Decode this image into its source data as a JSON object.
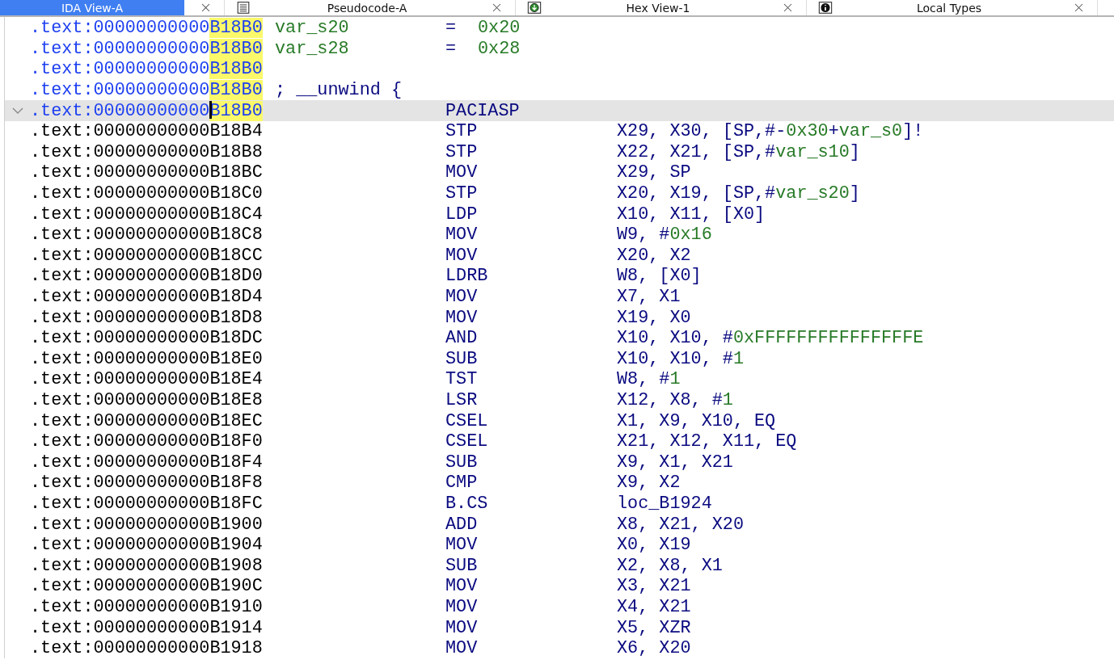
{
  "tabs": [
    {
      "label": "IDA View-A",
      "selected": true
    },
    {
      "label": "Pseudocode-A",
      "selected": false
    },
    {
      "label": "Hex View-1",
      "selected": false
    },
    {
      "label": "Local Types",
      "selected": false
    }
  ],
  "lines": [
    {
      "kind": "header",
      "addr": ".text:00000000000",
      "addr_tail": "B18B0",
      "highlight": true,
      "active": true,
      "selected": false,
      "label": "var_s20",
      "mnemonic": "=",
      "operands": [
        {
          "text": "0x20",
          "kind": "num"
        }
      ]
    },
    {
      "kind": "header",
      "addr": ".text:00000000000",
      "addr_tail": "B18B0",
      "highlight": true,
      "active": true,
      "selected": false,
      "label": "var_s28",
      "mnemonic": "=",
      "operands": [
        {
          "text": "0x28",
          "kind": "num"
        }
      ]
    },
    {
      "kind": "header",
      "addr": ".text:00000000000",
      "addr_tail": "B18B0",
      "highlight": true,
      "active": true,
      "selected": false
    },
    {
      "kind": "header",
      "addr": ".text:00000000000",
      "addr_tail": "B18B0",
      "highlight": true,
      "active": true,
      "selected": false,
      "comment": "; __unwind {"
    },
    {
      "kind": "code",
      "addr": ".text:00000000000",
      "addr_tail": "B18B0",
      "highlight": true,
      "active": true,
      "selected": true,
      "mnemonic": "PACIASP"
    },
    {
      "kind": "code",
      "addr": ".text:00000000000",
      "addr_tail": "B18B4",
      "highlight": false,
      "active": false,
      "selected": false,
      "mnemonic": "STP",
      "operands": [
        {
          "text": "X29, X30, [SP,#-",
          "kind": "reg"
        },
        {
          "text": "0x30",
          "kind": "num"
        },
        {
          "text": "+",
          "kind": "reg"
        },
        {
          "text": "var_s0",
          "kind": "num"
        },
        {
          "text": "]!",
          "kind": "reg"
        }
      ]
    },
    {
      "kind": "code",
      "addr": ".text:00000000000",
      "addr_tail": "B18B8",
      "highlight": false,
      "active": false,
      "selected": false,
      "mnemonic": "STP",
      "operands": [
        {
          "text": "X22, X21, [SP,#",
          "kind": "reg"
        },
        {
          "text": "var_s10",
          "kind": "num"
        },
        {
          "text": "]",
          "kind": "reg"
        }
      ]
    },
    {
      "kind": "code",
      "addr": ".text:00000000000",
      "addr_tail": "B18BC",
      "highlight": false,
      "active": false,
      "selected": false,
      "mnemonic": "MOV",
      "operands": [
        {
          "text": "X29, SP",
          "kind": "reg"
        }
      ]
    },
    {
      "kind": "code",
      "addr": ".text:00000000000",
      "addr_tail": "B18C0",
      "highlight": false,
      "active": false,
      "selected": false,
      "mnemonic": "STP",
      "operands": [
        {
          "text": "X20, X19, [SP,#",
          "kind": "reg"
        },
        {
          "text": "var_s20",
          "kind": "num"
        },
        {
          "text": "]",
          "kind": "reg"
        }
      ]
    },
    {
      "kind": "code",
      "addr": ".text:00000000000",
      "addr_tail": "B18C4",
      "highlight": false,
      "active": false,
      "selected": false,
      "mnemonic": "LDP",
      "operands": [
        {
          "text": "X10, X11, [X0]",
          "kind": "reg"
        }
      ]
    },
    {
      "kind": "code",
      "addr": ".text:00000000000",
      "addr_tail": "B18C8",
      "highlight": false,
      "active": false,
      "selected": false,
      "mnemonic": "MOV",
      "operands": [
        {
          "text": "W9, #",
          "kind": "reg"
        },
        {
          "text": "0x16",
          "kind": "num"
        }
      ]
    },
    {
      "kind": "code",
      "addr": ".text:00000000000",
      "addr_tail": "B18CC",
      "highlight": false,
      "active": false,
      "selected": false,
      "mnemonic": "MOV",
      "operands": [
        {
          "text": "X20, X2",
          "kind": "reg"
        }
      ]
    },
    {
      "kind": "code",
      "addr": ".text:00000000000",
      "addr_tail": "B18D0",
      "highlight": false,
      "active": false,
      "selected": false,
      "mnemonic": "LDRB",
      "operands": [
        {
          "text": "W8, [X0]",
          "kind": "reg"
        }
      ]
    },
    {
      "kind": "code",
      "addr": ".text:00000000000",
      "addr_tail": "B18D4",
      "highlight": false,
      "active": false,
      "selected": false,
      "mnemonic": "MOV",
      "operands": [
        {
          "text": "X7, X1",
          "kind": "reg"
        }
      ]
    },
    {
      "kind": "code",
      "addr": ".text:00000000000",
      "addr_tail": "B18D8",
      "highlight": false,
      "active": false,
      "selected": false,
      "mnemonic": "MOV",
      "operands": [
        {
          "text": "X19, X0",
          "kind": "reg"
        }
      ]
    },
    {
      "kind": "code",
      "addr": ".text:00000000000",
      "addr_tail": "B18DC",
      "highlight": false,
      "active": false,
      "selected": false,
      "mnemonic": "AND",
      "operands": [
        {
          "text": "X10, X10, #",
          "kind": "reg"
        },
        {
          "text": "0xFFFFFFFFFFFFFFFE",
          "kind": "num"
        }
      ]
    },
    {
      "kind": "code",
      "addr": ".text:00000000000",
      "addr_tail": "B18E0",
      "highlight": false,
      "active": false,
      "selected": false,
      "mnemonic": "SUB",
      "operands": [
        {
          "text": "X10, X10, #",
          "kind": "reg"
        },
        {
          "text": "1",
          "kind": "num"
        }
      ]
    },
    {
      "kind": "code",
      "addr": ".text:00000000000",
      "addr_tail": "B18E4",
      "highlight": false,
      "active": false,
      "selected": false,
      "mnemonic": "TST",
      "operands": [
        {
          "text": "W8, #",
          "kind": "reg"
        },
        {
          "text": "1",
          "kind": "num"
        }
      ]
    },
    {
      "kind": "code",
      "addr": ".text:00000000000",
      "addr_tail": "B18E8",
      "highlight": false,
      "active": false,
      "selected": false,
      "mnemonic": "LSR",
      "operands": [
        {
          "text": "X12, X8, #",
          "kind": "reg"
        },
        {
          "text": "1",
          "kind": "num"
        }
      ]
    },
    {
      "kind": "code",
      "addr": ".text:00000000000",
      "addr_tail": "B18EC",
      "highlight": false,
      "active": false,
      "selected": false,
      "mnemonic": "CSEL",
      "operands": [
        {
          "text": "X1, X9, X10, EQ",
          "kind": "reg"
        }
      ]
    },
    {
      "kind": "code",
      "addr": ".text:00000000000",
      "addr_tail": "B18F0",
      "highlight": false,
      "active": false,
      "selected": false,
      "mnemonic": "CSEL",
      "operands": [
        {
          "text": "X21, X12, X11, EQ",
          "kind": "reg"
        }
      ]
    },
    {
      "kind": "code",
      "addr": ".text:00000000000",
      "addr_tail": "B18F4",
      "highlight": false,
      "active": false,
      "selected": false,
      "mnemonic": "SUB",
      "operands": [
        {
          "text": "X9, X1, X21",
          "kind": "reg"
        }
      ]
    },
    {
      "kind": "code",
      "addr": ".text:00000000000",
      "addr_tail": "B18F8",
      "highlight": false,
      "active": false,
      "selected": false,
      "mnemonic": "CMP",
      "operands": [
        {
          "text": "X9, X2",
          "kind": "reg"
        }
      ]
    },
    {
      "kind": "code",
      "addr": ".text:00000000000",
      "addr_tail": "B18FC",
      "highlight": false,
      "active": false,
      "selected": false,
      "mnemonic": "B.CS",
      "operands": [
        {
          "text": "loc_B1924",
          "kind": "reg"
        }
      ]
    },
    {
      "kind": "code",
      "addr": ".text:00000000000",
      "addr_tail": "B1900",
      "highlight": false,
      "active": false,
      "selected": false,
      "mnemonic": "ADD",
      "operands": [
        {
          "text": "X8, X21, X20",
          "kind": "reg"
        }
      ]
    },
    {
      "kind": "code",
      "addr": ".text:00000000000",
      "addr_tail": "B1904",
      "highlight": false,
      "active": false,
      "selected": false,
      "mnemonic": "MOV",
      "operands": [
        {
          "text": "X0, X19",
          "kind": "reg"
        }
      ]
    },
    {
      "kind": "code",
      "addr": ".text:00000000000",
      "addr_tail": "B1908",
      "highlight": false,
      "active": false,
      "selected": false,
      "mnemonic": "SUB",
      "operands": [
        {
          "text": "X2, X8, X1",
          "kind": "reg"
        }
      ]
    },
    {
      "kind": "code",
      "addr": ".text:00000000000",
      "addr_tail": "B190C",
      "highlight": false,
      "active": false,
      "selected": false,
      "mnemonic": "MOV",
      "operands": [
        {
          "text": "X3, X21",
          "kind": "reg"
        }
      ]
    },
    {
      "kind": "code",
      "addr": ".text:00000000000",
      "addr_tail": "B1910",
      "highlight": false,
      "active": false,
      "selected": false,
      "mnemonic": "MOV",
      "operands": [
        {
          "text": "X4, X21",
          "kind": "reg"
        }
      ]
    },
    {
      "kind": "code",
      "addr": ".text:00000000000",
      "addr_tail": "B1914",
      "highlight": false,
      "active": false,
      "selected": false,
      "mnemonic": "MOV",
      "operands": [
        {
          "text": "X5, XZR",
          "kind": "reg"
        }
      ]
    },
    {
      "kind": "code",
      "addr": ".text:00000000000",
      "addr_tail": "B1918",
      "highlight": false,
      "active": false,
      "selected": false,
      "mnemonic": "MOV",
      "operands": [
        {
          "text": "X6, X20",
          "kind": "reg"
        }
      ]
    }
  ]
}
